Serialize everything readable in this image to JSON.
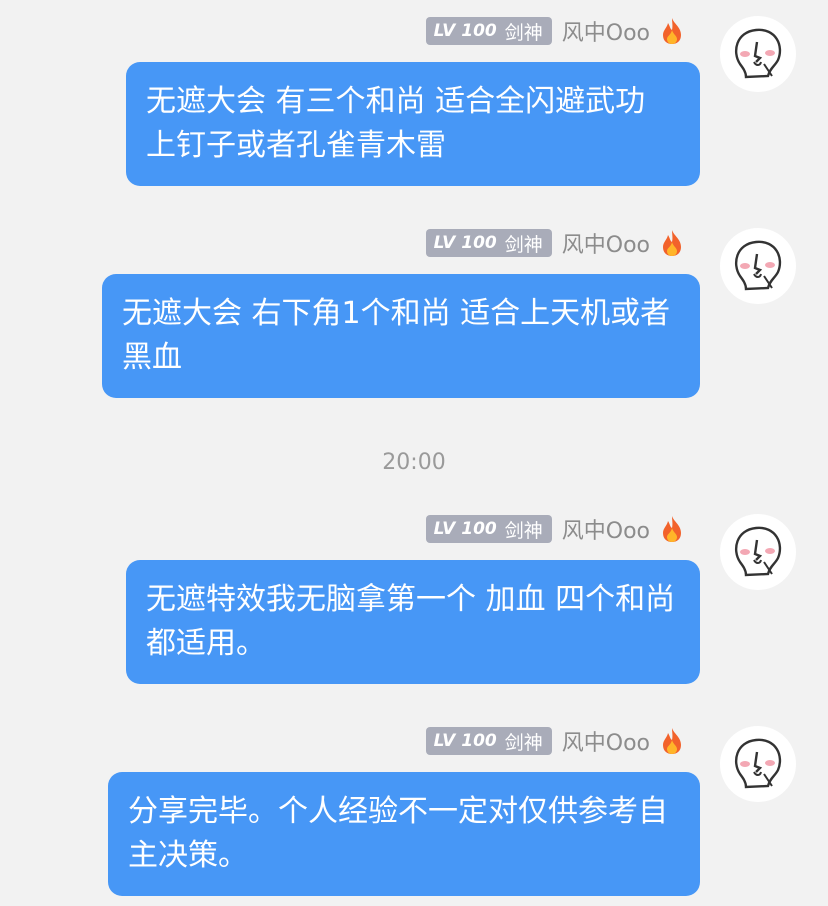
{
  "sender": {
    "level": "LV 100",
    "title": "剑神",
    "nickname": "风中Ooo",
    "badge_color": "#a9acb9",
    "icon": "fire-icon"
  },
  "bubble_color": "#4797f6",
  "timestamp": "20:00",
  "messages": [
    {
      "text": "无遮大会 有三个和尚 适合全闪避武功 上钉子或者孔雀青木雷"
    },
    {
      "text": "无遮大会 右下角1个和尚 适合上天机或者黑血"
    },
    {
      "text": "无遮特效我无脑拿第一个 加血 四个和尚都适用。"
    },
    {
      "text": "分享完毕。个人经验不一定对仅供参考自主决策。"
    }
  ]
}
